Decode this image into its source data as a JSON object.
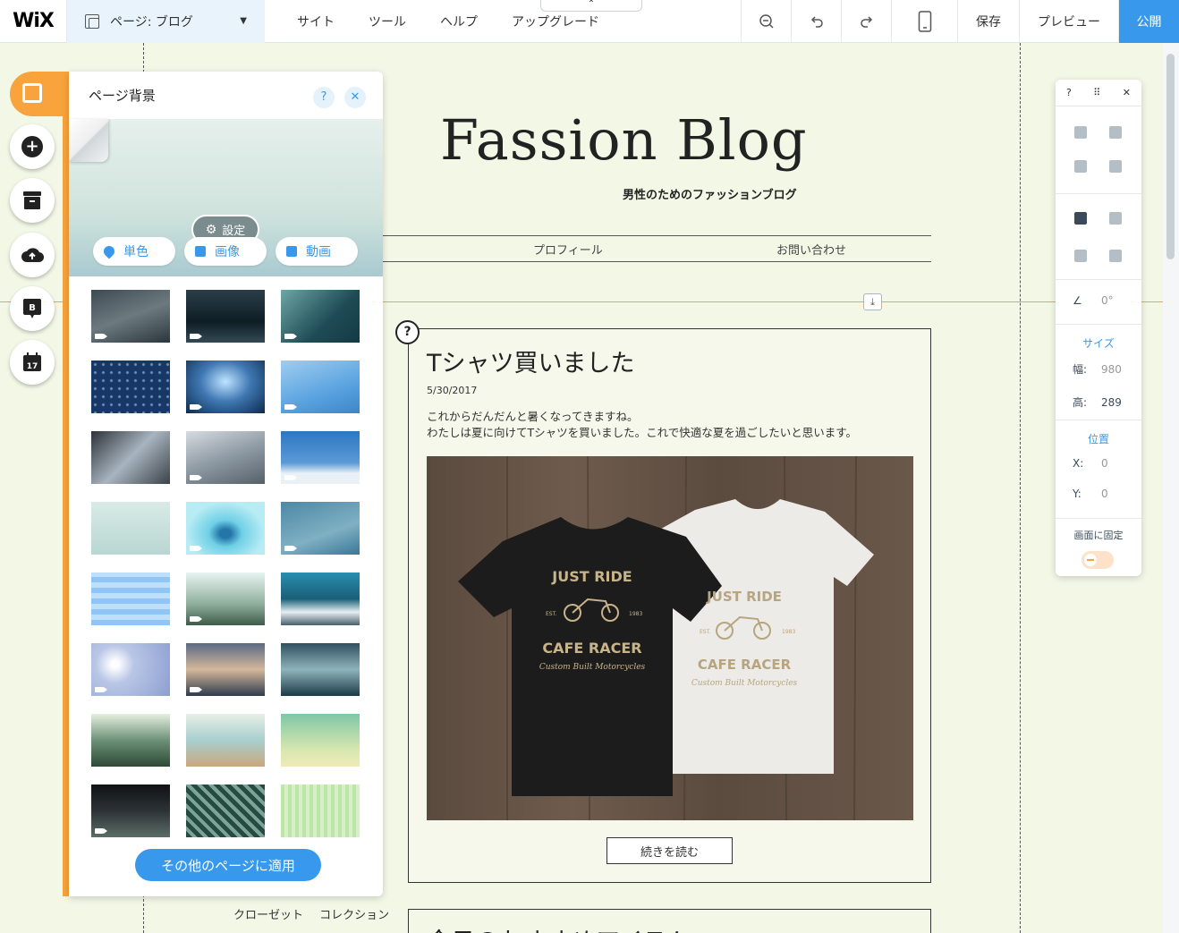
{
  "topbar": {
    "logo": "WiX",
    "page_label": "ページ: ブログ",
    "menu": [
      "サイト",
      "ツール",
      "ヘルプ",
      "アップグレード"
    ],
    "save": "保存",
    "preview": "プレビュー",
    "publish": "公開",
    "collapse_glyph": "⌃"
  },
  "panel": {
    "title": "ページ背景",
    "help": "?",
    "close": "✕",
    "settings": "設定",
    "types": [
      "単色",
      "画像",
      "動画"
    ],
    "apply_button": "その他のページに適用"
  },
  "site": {
    "title": "Fassion Blog",
    "subtitle": "男性のためのファッションブログ",
    "nav": [
      "プロフィール",
      "お問い合わせ"
    ]
  },
  "post": {
    "title": "Tシャツ買いました",
    "date": "5/30/2017",
    "body_line1": "これからだんだんと暑くなってきますね。",
    "body_line2": "わたしは夏に向けてTシャツを買いました。これで快適な夏を過ごしたいと思います。",
    "read_more": "続きを読む",
    "shirt_text_top": "JUST RIDE",
    "shirt_text_mid": "CAFE RACER",
    "shirt_text_sub": "Custom Built Motorcycles",
    "shirt_est": "EST.",
    "shirt_year": "1983"
  },
  "post2": {
    "title": "今日のおすすめアイテム"
  },
  "footer_links": [
    "クローゼット",
    "コレクション"
  ],
  "inspector": {
    "help": "?",
    "drag": "⠿",
    "close": "✕",
    "angle": "0°",
    "size_label": "サイズ",
    "width_label": "幅:",
    "width_value": "980",
    "height_label": "高:",
    "height_value": "289",
    "position_label": "位置",
    "x_label": "X:",
    "x_value": "0",
    "y_label": "Y:",
    "y_value": "0",
    "pin_label": "画面に固定"
  },
  "help_badge": "?",
  "colors": {
    "accent": "#3899ec",
    "orange": "#f8a33c"
  }
}
